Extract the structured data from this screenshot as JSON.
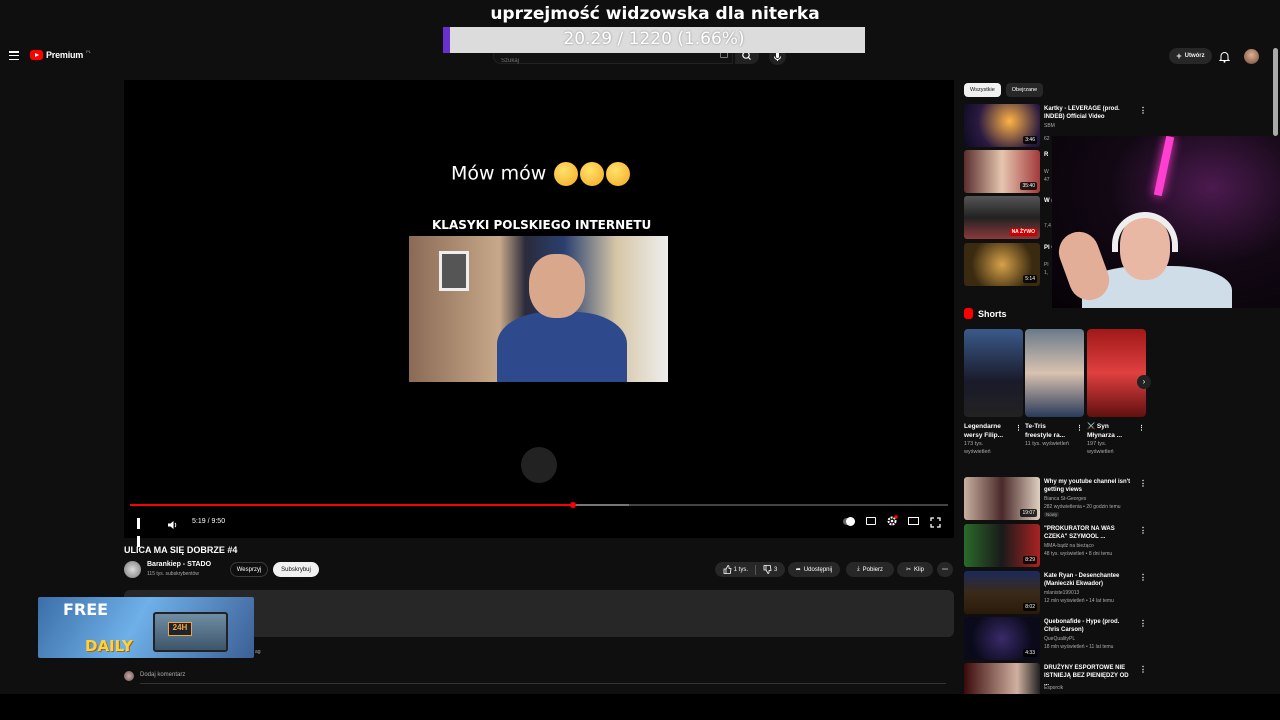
{
  "overlay": {
    "title": "uprzejmość widzowska dla niterka",
    "goal_text": "20.29 / 1220 (1.66%)",
    "goal_fraction": 0.0166,
    "goal_color": "#6a2fcf"
  },
  "header": {
    "logo_text": "Premium",
    "logo_country": "PL",
    "search_placeholder": "Szukaj",
    "create_label": "Utwórz"
  },
  "player": {
    "caption": "Mów mów",
    "heading": "KLASYKI POLSKIEGO INTERNETU",
    "time": "5:19 / 9:50",
    "played_fraction": 0.541,
    "buffered_fraction": 0.61,
    "accent": "#ff0000"
  },
  "video": {
    "title": "ULICA MA SIĘ DOBRZE #4",
    "channel": "Barankiep - STADO",
    "subscribers": "115 tys. subskrybentów",
    "join_label": "Wesprzyj",
    "subscribe_label": "Subskrybuj",
    "likes": "1 tys.",
    "dislikes": "3",
    "share_label": "Udostępnij",
    "download_label": "Pobierz",
    "clip_label": "Klip",
    "more_label": "⋯",
    "desc_tag": "ag",
    "comment_placeholder": "Dodaj komentarz"
  },
  "banner": {
    "free": "FREE",
    "daily": "DAILY",
    "badge": "24H"
  },
  "sidebar": {
    "chips": [
      "Wszystkie",
      "Obejrzane"
    ],
    "top_recs": [
      {
        "title": "Kartky - LEVERAGE (prod. INDEB) Official Video",
        "channel": "SBM",
        "meta": "62",
        "duration": "3:46"
      },
      {
        "title": "R",
        "channel": "W",
        "meta": "47",
        "duration": "35:40"
      },
      {
        "title": "W (V",
        "channel": "",
        "meta": "7,4",
        "duration": "NA ŻYWO"
      },
      {
        "title": "Pl Cr",
        "channel": "Pl",
        "meta": "1,",
        "duration": "5:14"
      }
    ],
    "shorts_label": "Shorts",
    "shorts": [
      {
        "title": "Legendarne wersy Filip...",
        "views": "173 tys. wyświetleń"
      },
      {
        "title": "Te-Tris freestyle ra...",
        "views": "11 tys. wyświetleń"
      },
      {
        "title": "⚔️ Syn Młynarza ...",
        "views": "197 tys. wyświetleń"
      }
    ],
    "bottom_recs": [
      {
        "title": "Why my youtube channel isn't getting views",
        "channel": "Bianca St-Georges",
        "meta": "282 wyświetlenia • 20 godzin temu",
        "badge": "Nowy",
        "duration": "19:07"
      },
      {
        "title": "\"PROKURATOR NA WAS CZEKA\" SZYMOOL ...",
        "channel": "MMA-bądź na bieżąco",
        "meta": "48 tys. wyświetleń • 8 dni temu",
        "badge": "",
        "duration": "8:29"
      },
      {
        "title": "Kate Ryan - Desenchantee (Manieczki Ekwador)",
        "channel": "mlaniste199013",
        "meta": "12 mln wyświetleń • 14 lat temu",
        "badge": "",
        "duration": "8:02"
      },
      {
        "title": "Quebonafide - Hype (prod. Chris Carson)",
        "channel": "QueQualityPL",
        "meta": "18 mln wyświetleń • 11 lat temu",
        "badge": "",
        "duration": "4:33"
      },
      {
        "title": "DRUŻYNY ESPORTOWE NIE ISTNIEJĄ BEZ PIENIĘDZY OD ...",
        "channel": "Esporcik",
        "meta": "",
        "badge": "",
        "duration": ""
      }
    ]
  }
}
